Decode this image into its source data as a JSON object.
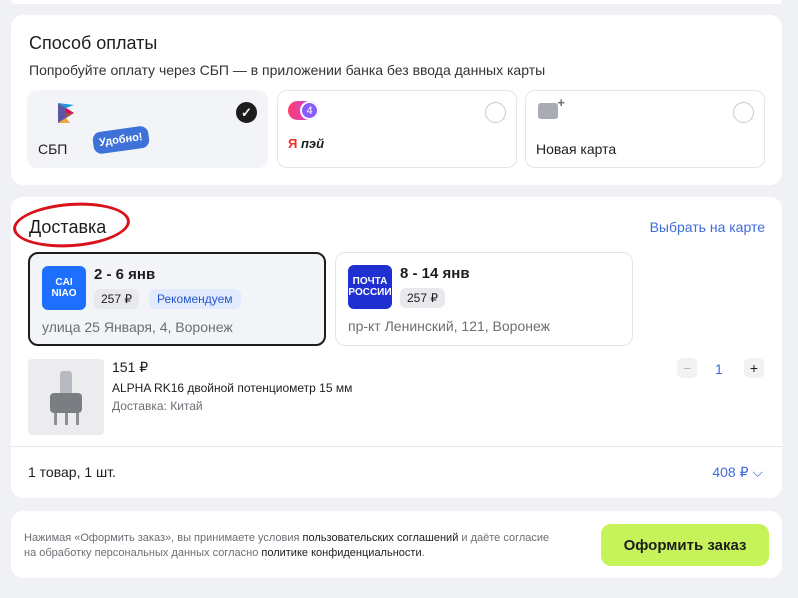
{
  "payment": {
    "title": "Способ оплаты",
    "subtitle": "Попробуйте оплату через СБП — в приложении банка без ввода данных карты",
    "options": [
      {
        "label": "СБП",
        "badge": "Удобно!",
        "selected": true,
        "check": "✓"
      },
      {
        "label": "пэй",
        "prefix": "Я",
        "split_number": "4",
        "selected": false
      },
      {
        "label": "Новая карта",
        "selected": false
      }
    ]
  },
  "delivery": {
    "title": "Доставка",
    "map_link": "Выбрать на карте",
    "options": [
      {
        "logo_text": "CAI NIAO",
        "dates": "2 - 6 янв",
        "price": "257 ₽",
        "badge": "Рекомендуем",
        "address": "улица 25 Января, 4, Воронеж",
        "selected": true
      },
      {
        "logo_text": "ПОЧТА РОССИИ",
        "dates": "8 - 14 янв",
        "price": "257 ₽",
        "address": "пр-кт Ленинский, 121, Воронеж",
        "selected": false
      }
    ],
    "product": {
      "price": "151 ₽",
      "name": "ALPHA RK16 двойной потенциометр 15 мм",
      "shipping": "Доставка: Китай",
      "quantity": "1",
      "minus": "−",
      "plus": "+"
    },
    "summary": {
      "count": "1 товар, 1 шт.",
      "total": "408 ₽"
    }
  },
  "footer": {
    "text_1": "Нажимая «Оформить заказ», вы принимаете условия ",
    "link_1": "пользовательских соглашений",
    "text_2": " и даёте согласие на обработку персональных данных согласно ",
    "link_2": "политике конфиденциальности",
    "text_3": ".",
    "order_button": "Оформить заказ"
  },
  "colors": {
    "accent": "#3e6cd8",
    "order_button": "#c6f25a",
    "highlight": "#d8131c"
  }
}
